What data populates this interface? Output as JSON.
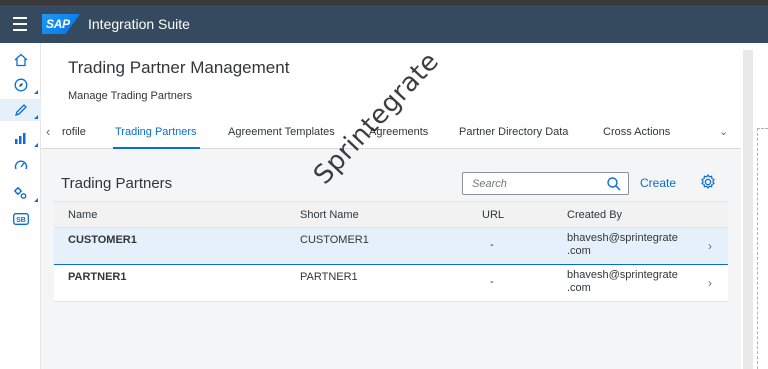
{
  "shell": {
    "logo_text": "SAP",
    "app_title": "Integration Suite"
  },
  "sidenav": {
    "items": [
      {
        "icon": "home-icon",
        "active": false
      },
      {
        "icon": "discover-icon",
        "active": false
      },
      {
        "icon": "design-pencil-icon",
        "active": true
      },
      {
        "icon": "monitor-chart-icon",
        "active": false
      },
      {
        "icon": "gauge-icon",
        "active": false
      },
      {
        "icon": "settings-gears-icon",
        "active": false
      },
      {
        "icon": "api-badge-icon",
        "active": false
      }
    ],
    "api_badge_text": "SB"
  },
  "header": {
    "title": "Trading Partner Management",
    "subtitle": "Manage Trading Partners"
  },
  "tabs": {
    "items": [
      {
        "label": "rofile",
        "selected": false
      },
      {
        "label": "Trading Partners",
        "selected": true
      },
      {
        "label": "Agreement Templates",
        "selected": false
      },
      {
        "label": "Agreements",
        "selected": false
      },
      {
        "label": "Partner Directory Data",
        "selected": false
      },
      {
        "label": "Cross Actions",
        "selected": false
      }
    ]
  },
  "card": {
    "title": "Trading Partners",
    "search_placeholder": "Search",
    "create_label": "Create"
  },
  "table": {
    "columns": [
      "Name",
      "Short Name",
      "URL",
      "Created By"
    ],
    "rows": [
      {
        "name": "CUSTOMER1",
        "short_name": "CUSTOMER1",
        "url": "-",
        "created_by_line1": "bhavesh@sprintegrate",
        "created_by_line2": ".com",
        "selected": true
      },
      {
        "name": "PARTNER1",
        "short_name": "PARTNER1",
        "url": "-",
        "created_by_line1": "bhavesh@sprintegrate",
        "created_by_line2": ".com",
        "selected": false
      }
    ]
  },
  "watermark": "Sprintegrate",
  "colors": {
    "shell": "#354a5f",
    "accent": "#0a6ed1",
    "selected_row": "#e5f0fa"
  }
}
